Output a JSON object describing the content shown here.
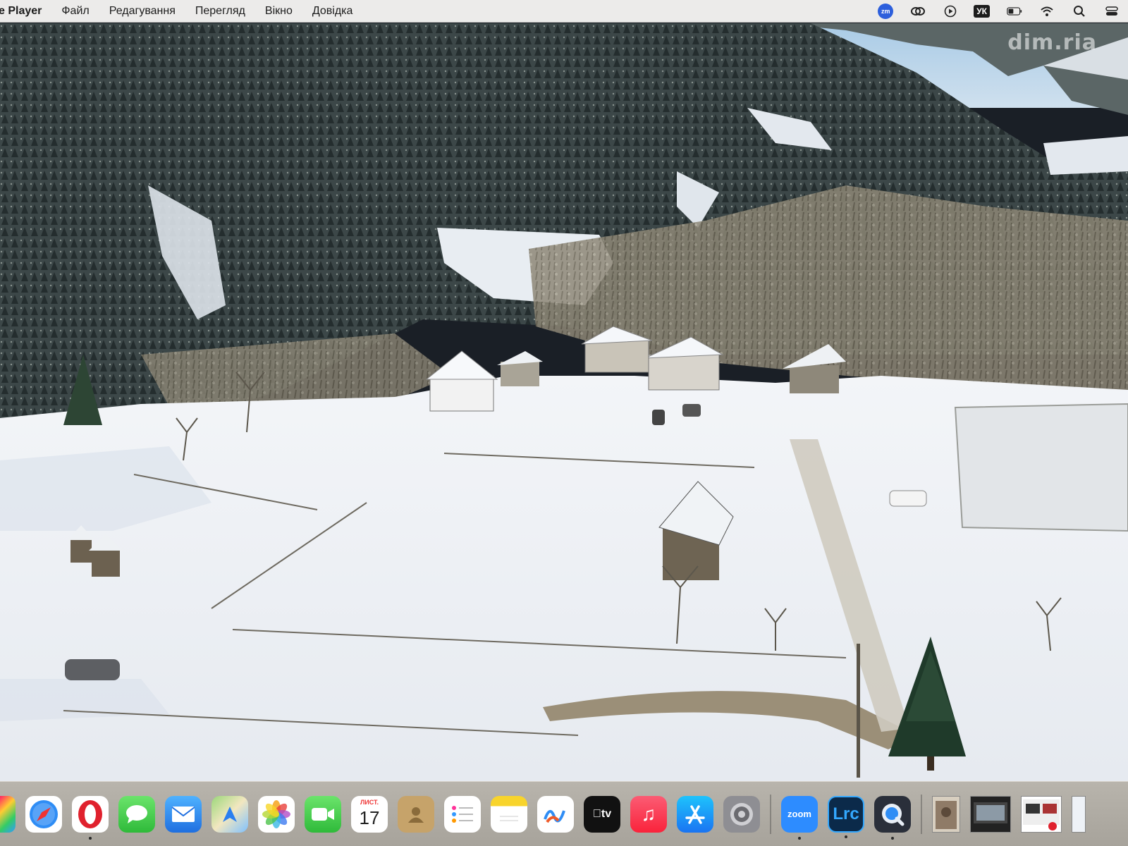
{
  "menubar": {
    "app_name": "e Player",
    "menus": [
      "Файл",
      "Редагування",
      "Перегляд",
      "Вікно",
      "Довідка"
    ],
    "status": {
      "zoom_badge": "zm",
      "lang": "УК"
    }
  },
  "watermark": "dim.ria",
  "dock": {
    "calendar_month": "ЛИСТ.",
    "calendar_day": "17",
    "zoom_label": "zoom",
    "lrc_label": "Lrc",
    "tv_label": "tv"
  },
  "colors": {
    "menubar_bg": "#ecebea",
    "dock_bg": "#aca89f",
    "snow": "#eef1f5",
    "forest": "#2f3b3c"
  }
}
